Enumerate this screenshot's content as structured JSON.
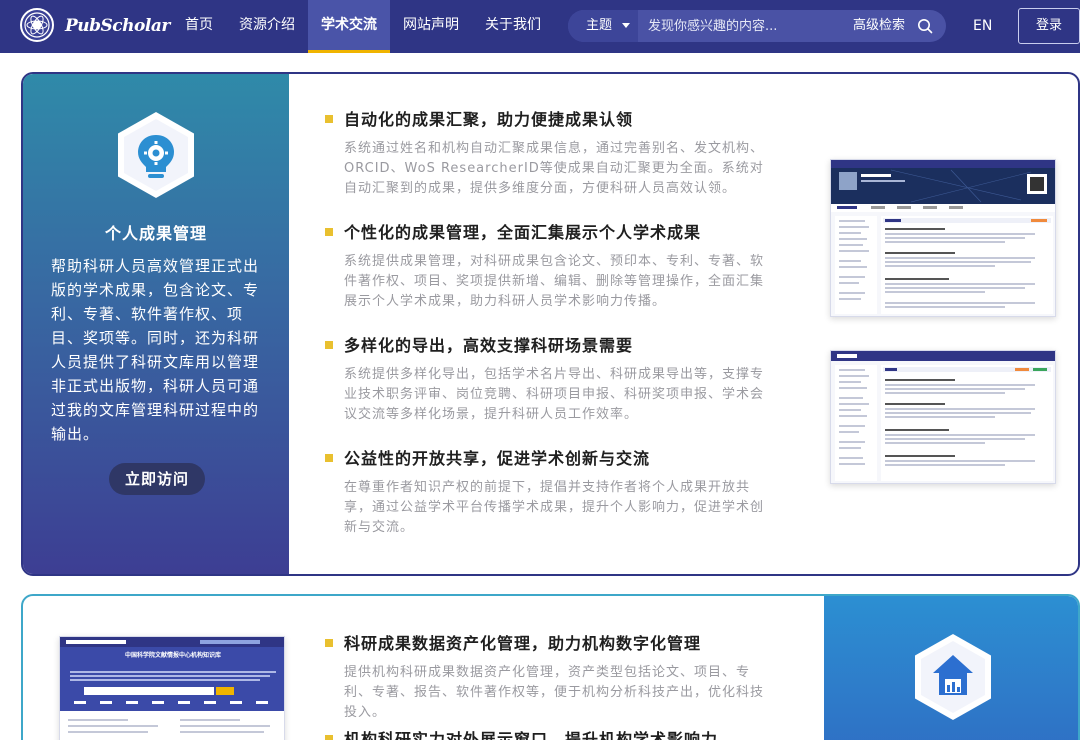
{
  "header": {
    "logo_text": "PubScholar",
    "nav": [
      {
        "label": "首页"
      },
      {
        "label": "资源介绍"
      },
      {
        "label": "学术交流",
        "active": true
      },
      {
        "label": "网站声明"
      },
      {
        "label": "关于我们"
      }
    ],
    "search": {
      "topic_label": "主题",
      "placeholder": "发现你感兴趣的内容...",
      "advanced_label": "高级检索"
    },
    "lang_label": "EN",
    "login_label": "登录"
  },
  "card_personal": {
    "icon": "lightbulb-gear-icon",
    "title": "个人成果管理",
    "description": "帮助科研人员高效管理正式出版的学术成果，包含论文、专利、专著、软件著作权、项目、奖项等。同时，还为科研人员提供了科研文库用以管理非正式出版物，科研人员可通过我的文库管理科研过程中的输出。",
    "visit_label": "立即访问",
    "features": [
      {
        "title": "自动化的成果汇聚，助力便捷成果认领",
        "description": "系统通过姓名和机构自动汇聚成果信息，通过完善别名、发文机构、ORCID、WoS ResearcherID等使成果自动汇聚更为全面。系统对自动汇聚到的成果，提供多维度分面，方便科研人员高效认领。"
      },
      {
        "title": "个性化的成果管理，全面汇集展示个人学术成果",
        "description": "系统提供成果管理，对科研成果包含论文、预印本、专利、专著、软件著作权、项目、奖项提供新增、编辑、删除等管理操作，全面汇集展示个人学术成果，助力科研人员学术影响力传播。"
      },
      {
        "title": "多样化的导出，高效支撑科研场景需要",
        "description": "系统提供多样化导出，包括学术名片导出、科研成果导出等，支撑专业技术职务评审、岗位竞聘、科研项目申报、科研奖项申报、学术会议交流等多样化场景，提升科研人员工作效率。"
      },
      {
        "title": "公益性的开放共享，促进学术创新与交流",
        "description": "在尊重作者知识产权的前提下，提倡并支持作者将个人成果开放共享，通过公益学术平台传播学术成果，提升个人影响力，促进学术创新与交流。"
      }
    ]
  },
  "card_institution": {
    "icon": "house-chart-icon",
    "preview_title": "中国科学院文献情报中心机构知识库",
    "features": [
      {
        "title": "科研成果数据资产化管理，助力机构数字化管理",
        "description": "提供机构科研成果数据资产化管理，资产类型包括论文、项目、专利、专著、报告、软件著作权等，便于机构分析科技产出，优化科技投入。"
      },
      {
        "title": "机构科研实力对外展示窗口，提升机构学术影响力",
        "description": ""
      }
    ]
  },
  "colors": {
    "header_bg": "#2f3585",
    "accent_yellow": "#e9c02f",
    "card_border": "#2f3585",
    "card2_border": "#3ea7c9"
  }
}
